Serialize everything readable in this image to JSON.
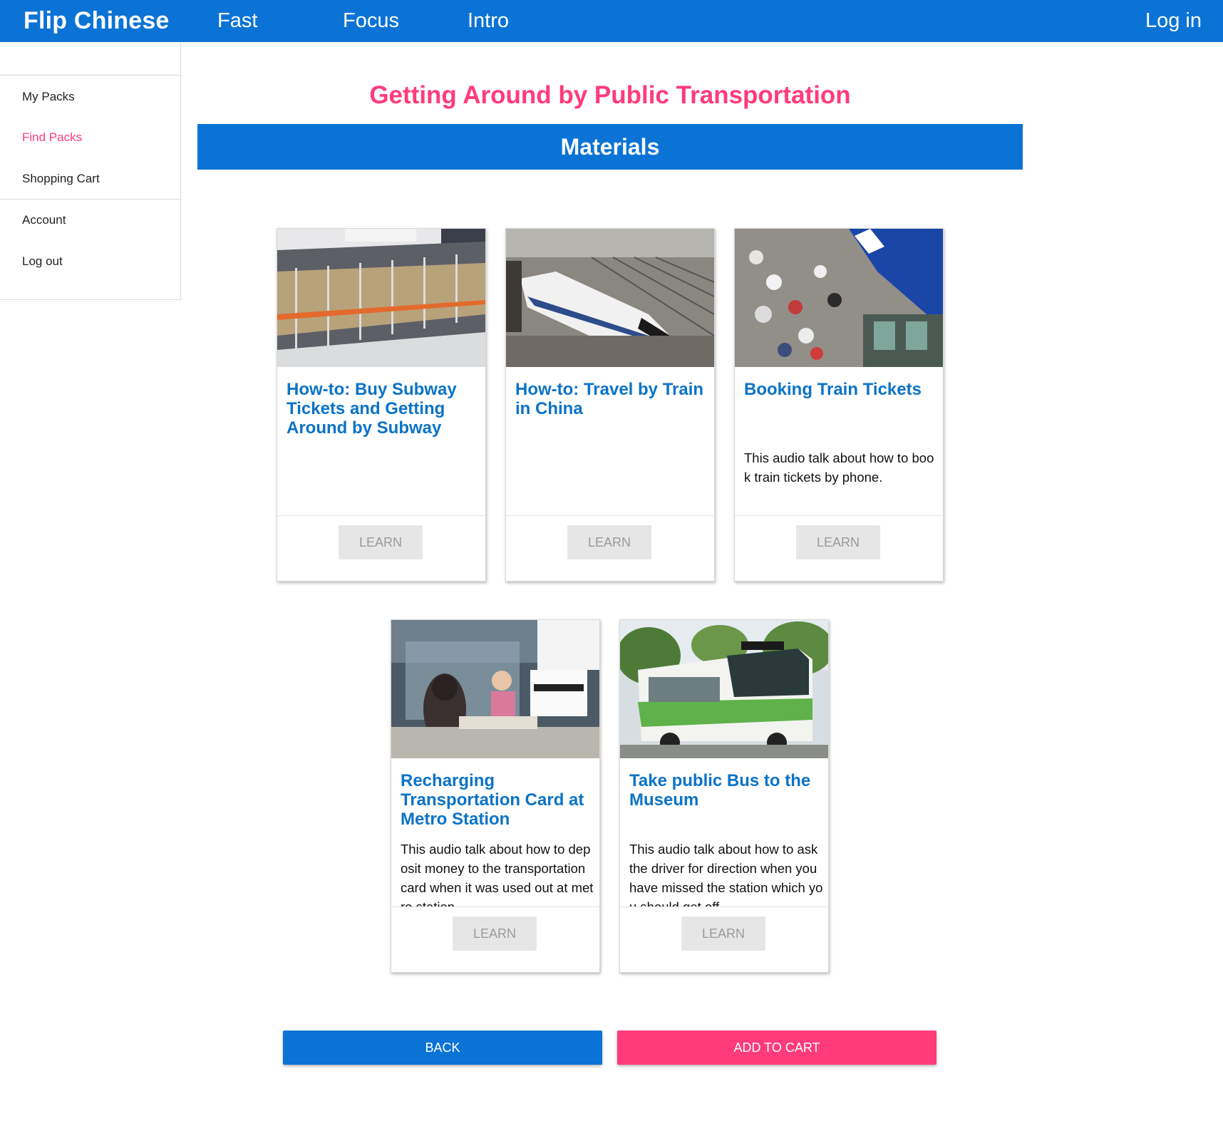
{
  "header": {
    "brand": "Flip Chinese",
    "nav": [
      "Fast",
      "Focus",
      "Intro"
    ],
    "login": "Log in"
  },
  "sidebar": {
    "items": [
      "My Packs",
      "Find Packs",
      "Shopping Cart",
      "Account",
      "Log out"
    ],
    "active_item": "Find Packs"
  },
  "main": {
    "title": "Getting Around by Public Transportation",
    "section": "Materials",
    "cards": [
      {
        "title": "How-to: Buy Subway Tickets and Getting Around by Subway",
        "desc": "",
        "image": "subway-platform-photo",
        "button": "LEARN"
      },
      {
        "title": "How-to: Travel by Train in China",
        "desc": "",
        "image": "high-speed-train-photo",
        "button": "LEARN"
      },
      {
        "title": "Booking Train Tickets",
        "desc": "This audio talk about how to book train tickets by phone.",
        "image": "ticket-office-photo",
        "button": "LEARN"
      },
      {
        "title": "Recharging Transportation Card at Metro Station",
        "desc": "This audio talk about how to deposit money to the transportation card when it was used out at metro station.",
        "image": "metro-service-counter-photo",
        "button": "LEARN"
      },
      {
        "title": "Take public Bus to the Museum",
        "desc": "This audio talk about how to ask the driver for direction when you have missed the station which you should get off.",
        "image": "city-bus-photo",
        "button": "LEARN"
      }
    ],
    "back_button": "BACK",
    "add_to_cart_button": "ADD TO CART"
  },
  "colors": {
    "primary": "#0b73d6",
    "accent": "#ff3b7a",
    "card_title": "#0b73c7",
    "learn_bg": "#e6e6e6"
  }
}
